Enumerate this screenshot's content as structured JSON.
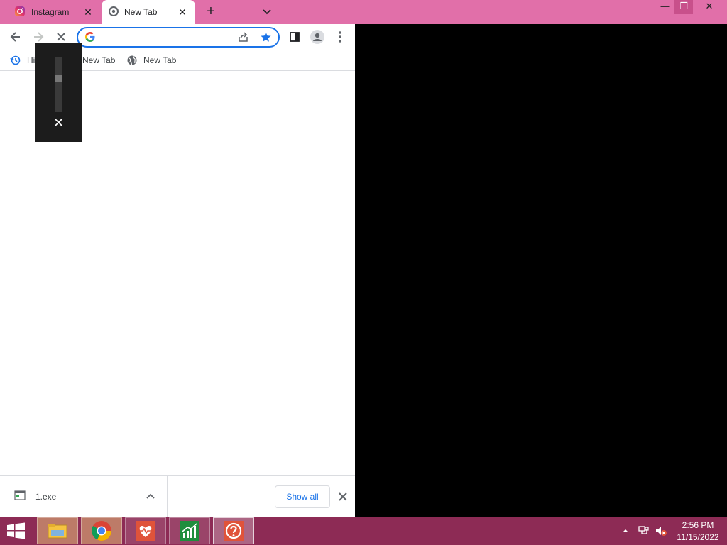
{
  "tabs": [
    {
      "title": "Instagram",
      "close": "✕"
    },
    {
      "title": "New Tab",
      "close": "✕"
    }
  ],
  "new_tab_symbol": "+",
  "window_controls": {
    "minimize": "—",
    "maximize": "❐",
    "close": "✕"
  },
  "omnibox": {
    "value": "",
    "placeholder": ""
  },
  "bookmarks": [
    {
      "label": "Hi",
      "icon": "history-icon"
    },
    {
      "label": "New Tab",
      "icon": "chrome-icon"
    },
    {
      "label": "New Tab",
      "icon": "globe-icon"
    }
  ],
  "downloads": {
    "file_name": "1.exe",
    "show_all_label": "Show all"
  },
  "volume_overlay": {
    "level": 0.62,
    "close": "✕"
  },
  "taskbar": {
    "apps": [
      "file-explorer-icon",
      "chrome-icon",
      "health-app-icon",
      "chart-app-icon",
      "help-app-icon"
    ],
    "time": "2:56 PM",
    "date": "11/15/2022"
  },
  "colors": {
    "tabstrip": "#e16fa9",
    "taskbar": "#8d2b55",
    "accent": "#1a73e8"
  }
}
